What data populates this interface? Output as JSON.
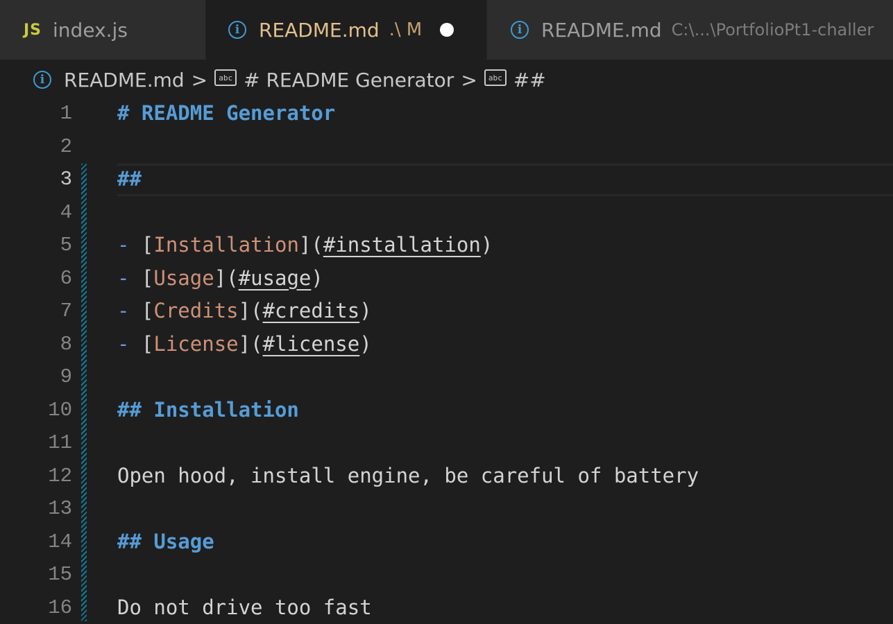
{
  "tabs": [
    {
      "icon": "js-icon",
      "icon_text": "JS",
      "label": "index.js"
    },
    {
      "icon": "info-icon",
      "label": "README.md",
      "path": ".\\",
      "status": "M",
      "dirty": true,
      "active": true
    },
    {
      "icon": "info-icon",
      "label": "README.md",
      "description": "C:\\...\\PortfolioPt1-challer"
    }
  ],
  "breadcrumb": {
    "file": "README.md",
    "items": [
      "# README Generator",
      "##"
    ],
    "separator": ">"
  },
  "editor": {
    "active_line": 3,
    "lines": [
      {
        "n": "1",
        "parts": [
          [
            "h",
            "# README Generator"
          ]
        ]
      },
      {
        "n": "2",
        "parts": []
      },
      {
        "n": "3",
        "parts": [
          [
            "h",
            "##"
          ]
        ]
      },
      {
        "n": "4",
        "parts": []
      },
      {
        "n": "5",
        "parts": [
          [
            "dash",
            "- "
          ],
          [
            "br",
            "["
          ],
          [
            "lt",
            "Installation"
          ],
          [
            "br",
            "]("
          ],
          [
            "link",
            "#installation"
          ],
          [
            "br",
            ")"
          ]
        ]
      },
      {
        "n": "6",
        "parts": [
          [
            "dash",
            "- "
          ],
          [
            "br",
            "["
          ],
          [
            "lt",
            "Usage"
          ],
          [
            "br",
            "]("
          ],
          [
            "link",
            "#usage"
          ],
          [
            "br",
            ")"
          ]
        ]
      },
      {
        "n": "7",
        "parts": [
          [
            "dash",
            "- "
          ],
          [
            "br",
            "["
          ],
          [
            "lt",
            "Credits"
          ],
          [
            "br",
            "]("
          ],
          [
            "link",
            "#credits"
          ],
          [
            "br",
            ")"
          ]
        ]
      },
      {
        "n": "8",
        "parts": [
          [
            "dash",
            "- "
          ],
          [
            "br",
            "["
          ],
          [
            "lt",
            "License"
          ],
          [
            "br",
            "]("
          ],
          [
            "link",
            "#license"
          ],
          [
            "br",
            ")"
          ]
        ]
      },
      {
        "n": "9",
        "parts": []
      },
      {
        "n": "10",
        "parts": [
          [
            "h",
            "## Installation"
          ]
        ]
      },
      {
        "n": "11",
        "parts": []
      },
      {
        "n": "12",
        "parts": [
          [
            "txt",
            "Open hood, install engine, be careful of battery"
          ]
        ]
      },
      {
        "n": "13",
        "parts": []
      },
      {
        "n": "14",
        "parts": [
          [
            "h",
            "## Usage"
          ]
        ]
      },
      {
        "n": "15",
        "parts": []
      },
      {
        "n": "16",
        "parts": [
          [
            "txt",
            "Do not drive too fast"
          ]
        ]
      }
    ]
  },
  "colors": {
    "editor_bg": "#1e1e1e",
    "tab_bg": "#2d2d2d",
    "heading": "#569cd6",
    "link_text": "#ce9178",
    "modified": "#e2c08d",
    "indent_guide": "#0c7d9d"
  }
}
